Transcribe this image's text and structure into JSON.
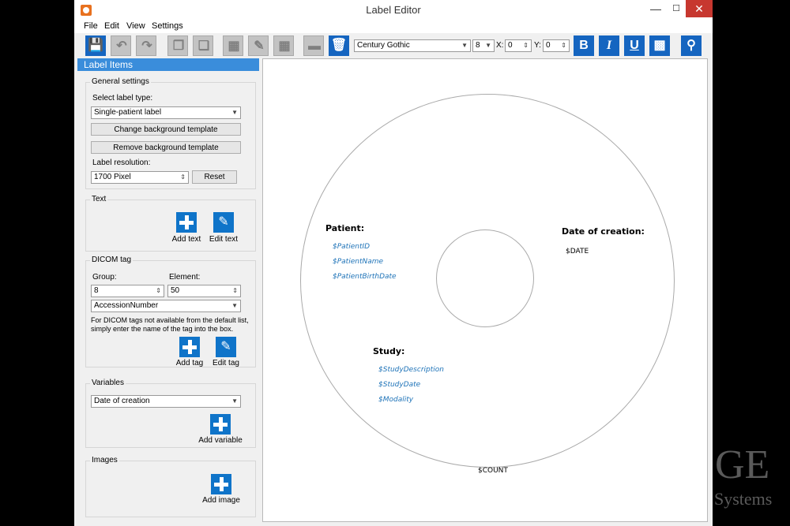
{
  "window": {
    "title": "Label Editor"
  },
  "menu": {
    "file": "File",
    "edit": "Edit",
    "view": "View",
    "settings": "Settings"
  },
  "toolbar": {
    "font": "Century Gothic",
    "size": "8",
    "x_label": "X:",
    "x_value": "0",
    "y_label": "Y:",
    "y_value": "0",
    "bold": "B",
    "italic": "I",
    "underline": "U"
  },
  "pane": {
    "title": "Label Items",
    "general": {
      "title": "General settings",
      "select_label_type": "Select label type:",
      "label_type": "Single-patient label",
      "change_bg": "Change background template",
      "remove_bg": "Remove background template",
      "resolution_label": "Label resolution:",
      "resolution": "1700 Pixel",
      "reset": "Reset"
    },
    "text": {
      "title": "Text",
      "add": "Add text",
      "edit": "Edit text"
    },
    "dicom": {
      "title": "DICOM tag",
      "group_label": "Group:",
      "group_value": "8",
      "element_label": "Element:",
      "element_value": "50",
      "tag": "AccessionNumber",
      "hint1": "For DICOM tags not available from the default list,",
      "hint2": "simply enter the name of the tag into the box.",
      "add": "Add tag",
      "edit": "Edit tag"
    },
    "variables": {
      "title": "Variables",
      "selected": "Date of creation",
      "add": "Add variable"
    },
    "images": {
      "title": "Images",
      "add": "Add image"
    }
  },
  "canvas": {
    "patient_heading": "Patient:",
    "patient_id": "$PatientID",
    "patient_name": "$PatientName",
    "patient_birthdate": "$PatientBirthDate",
    "date_heading": "Date of creation:",
    "date_var": "$DATE",
    "study_heading": "Study:",
    "study_description": "$StudyDescription",
    "study_date": "$StudyDate",
    "modality": "$Modality",
    "count": "$COUNT"
  },
  "watermark": {
    "line1": "GE",
    "line2": "Systems"
  },
  "colors": {
    "accent": "#1565c0",
    "header": "#3a8ddb",
    "close": "#c7372f",
    "variable_text": "#1e73b8"
  },
  "icons": {
    "toolbar": [
      "save-icon",
      "undo-icon",
      "redo-icon",
      "bring-front-icon",
      "send-back-icon",
      "align-icon",
      "edit-icon",
      "distribute-icon",
      "minus-icon",
      "delete-icon",
      "bold-icon",
      "italic-icon",
      "underline-icon",
      "fill-icon",
      "zoom-icon"
    ]
  }
}
